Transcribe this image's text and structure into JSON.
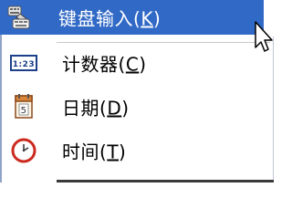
{
  "menu": {
    "items": [
      {
        "label": "键盘输入(K)",
        "label_main": "键盘输入(",
        "label_accel": "K",
        "label_tail": ")",
        "icon": "keyboard-icon",
        "highlighted": true
      },
      {
        "label": "计数器(C)",
        "label_main": "计数器(",
        "label_accel": "C",
        "label_tail": ")",
        "icon": "counter-icon",
        "icon_text": "1:23",
        "highlighted": false
      },
      {
        "label": "日期(D)",
        "label_main": "日期(",
        "label_accel": "D",
        "label_tail": ")",
        "icon": "calendar-icon",
        "icon_text": "5",
        "highlighted": false
      },
      {
        "label": "时间(T)",
        "label_main": "时间(",
        "label_accel": "T",
        "label_tail": ")",
        "icon": "clock-icon",
        "highlighted": false
      }
    ]
  },
  "colors": {
    "highlight": "#3169c6",
    "highlight_text": "#ffffff",
    "text": "#000000"
  }
}
